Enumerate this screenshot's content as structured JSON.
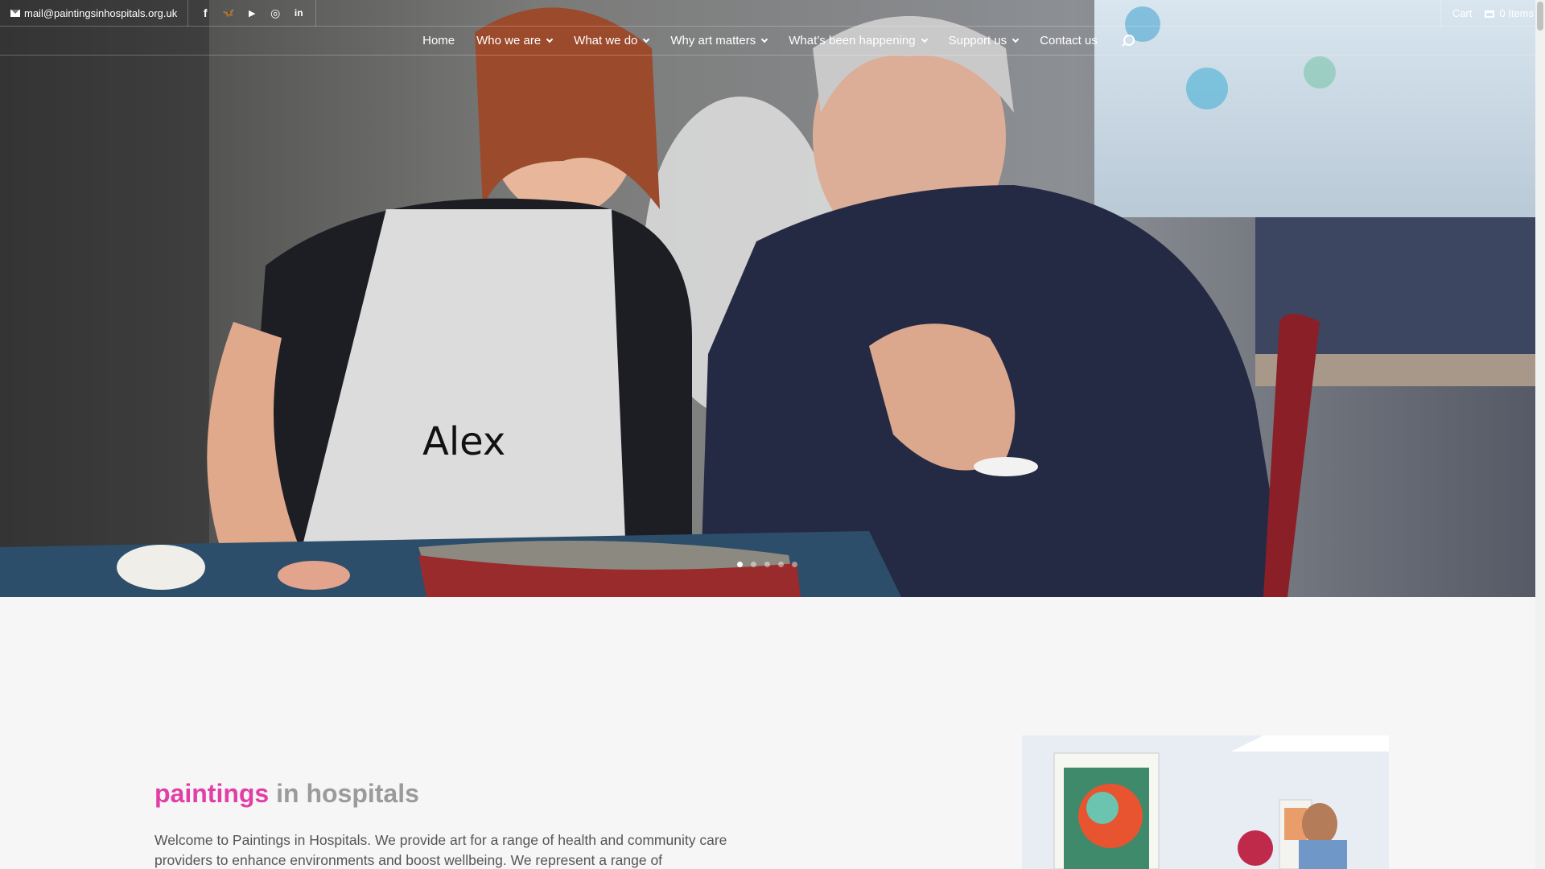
{
  "topbar": {
    "email": "mail@paintingsinhospitals.org.uk",
    "social": [
      {
        "icon": "facebook-icon",
        "glyph": "f"
      },
      {
        "icon": "bluesky-icon",
        "glyph": "🦋"
      },
      {
        "icon": "youtube-icon",
        "glyph": "▶"
      },
      {
        "icon": "instagram-icon",
        "glyph": "◎"
      },
      {
        "icon": "linkedin-icon",
        "glyph": "in"
      }
    ],
    "cart_label": "Cart",
    "cart_items": "0 Items"
  },
  "nav": {
    "items": [
      {
        "label": "Home",
        "dropdown": false
      },
      {
        "label": "Who we are",
        "dropdown": true
      },
      {
        "label": "What we do",
        "dropdown": true
      },
      {
        "label": "Why art matters",
        "dropdown": true
      },
      {
        "label": "What’s been happening",
        "dropdown": true
      },
      {
        "label": "Support us",
        "dropdown": true
      },
      {
        "label": "Contact us",
        "dropdown": false
      }
    ]
  },
  "hero": {
    "apron_text": "Alex",
    "slide_count": 5,
    "active_slide": 1
  },
  "intro": {
    "title_accent": "paintings",
    "title_rest": "in hospitals",
    "body": "Welcome to Paintings in Hospitals. We provide art for a range of health and community care providers to enhance environments and boost wellbeing. We represent a range of"
  },
  "colors": {
    "accent_pink": "#e23fa6",
    "title_grey": "#9b9b9b",
    "body_text": "#555555",
    "page_bg": "#f6f6f6"
  }
}
